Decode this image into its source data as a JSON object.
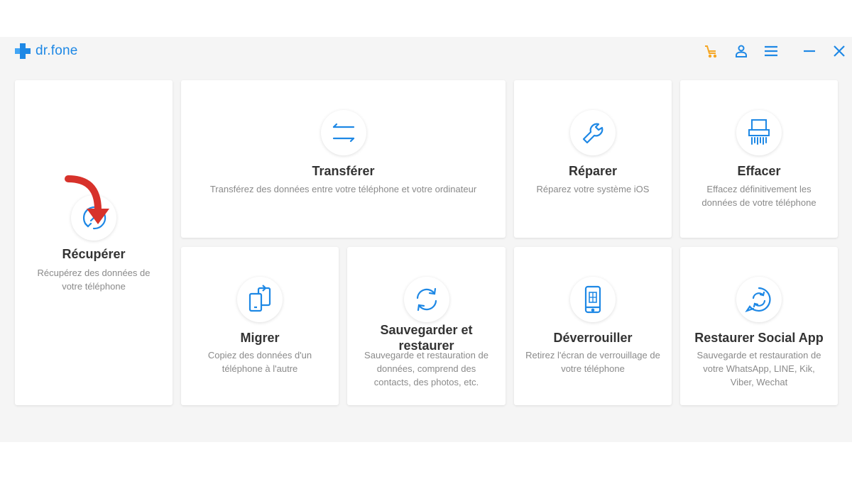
{
  "app": {
    "name": "dr.fone"
  },
  "colors": {
    "accent": "#1e88e5",
    "cart": "#f5a623",
    "arrow": "#d7322b"
  },
  "header_icons": [
    "cart-icon",
    "user-icon",
    "menu-icon",
    "minimize-icon",
    "close-icon"
  ],
  "cards": {
    "recuperer": {
      "icon": "clock-restore-icon",
      "title": "Récupérer",
      "desc1": "Récupérez des données de",
      "desc2": "votre téléphone"
    },
    "transferer": {
      "icon": "transfer-arrows-icon",
      "title": "Transférer",
      "desc1": "Transférez des données entre votre téléphone et votre ordinateur"
    },
    "reparer": {
      "icon": "wrench-icon",
      "title": "Réparer",
      "desc1": "Réparez votre système iOS"
    },
    "effacer": {
      "icon": "shredder-icon",
      "title": "Effacer",
      "desc1": "Effacez définitivement les",
      "desc2": "données de votre téléphone"
    },
    "migrer": {
      "icon": "phone-migrate-icon",
      "title": "Migrer",
      "desc1": "Copiez des données d'un",
      "desc2": "téléphone à l'autre"
    },
    "sauvegarder": {
      "icon": "sync-icon",
      "title1": "Sauvegarder et",
      "title2": "restaurer",
      "desc1": "Sauvegarde et restauration de",
      "desc2": "données, comprend des",
      "desc3": "contacts, des photos, etc."
    },
    "deverrouiller": {
      "icon": "phone-unlock-icon",
      "title": "Déverrouiller",
      "desc1": "Retirez l'écran de verrouillage de",
      "desc2": "votre téléphone"
    },
    "social": {
      "icon": "chat-sync-icon",
      "title": "Restaurer Social App",
      "desc1": "Sauvegarde et restauration de",
      "desc2": "votre WhatsApp, LINE, Kik,",
      "desc3": "Viber, Wechat"
    }
  }
}
